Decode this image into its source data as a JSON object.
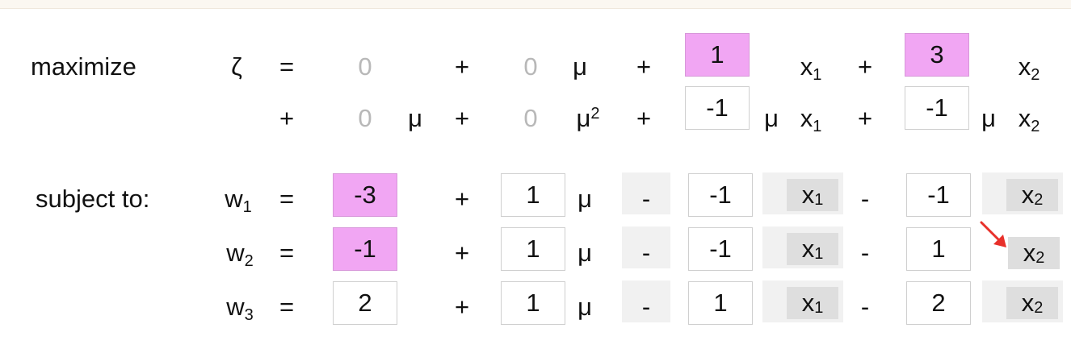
{
  "labels": {
    "maximize": "maximize",
    "subject_to": "subject to:",
    "zeta": "ζ",
    "eq": "=",
    "plus": "+",
    "minus": "-",
    "mu": "μ",
    "x": "x",
    "w": "w",
    "sub1": "1",
    "sub2": "2",
    "sub3": "3",
    "sq": "2"
  },
  "objective": {
    "row1": {
      "const": "0",
      "mu_coef": "0",
      "x1_coef": "1",
      "x2_coef": "3"
    },
    "row2": {
      "mu_coef": "0",
      "mu2_coef": "0",
      "x1_coef": "-1",
      "x2_coef": "-1"
    }
  },
  "constraints": [
    {
      "const": "-3",
      "mu_coef": "1",
      "x1_coef": "-1",
      "x2_coef": "-1"
    },
    {
      "const": "-1",
      "mu_coef": "1",
      "x1_coef": "-1",
      "x2_coef": "1"
    },
    {
      "const": "2",
      "mu_coef": "1",
      "x1_coef": "1",
      "x2_coef": "2"
    }
  ],
  "colors": {
    "highlight": "#f1a6f3",
    "variable_cell": "#dedede",
    "arrow": "#e8302a"
  }
}
